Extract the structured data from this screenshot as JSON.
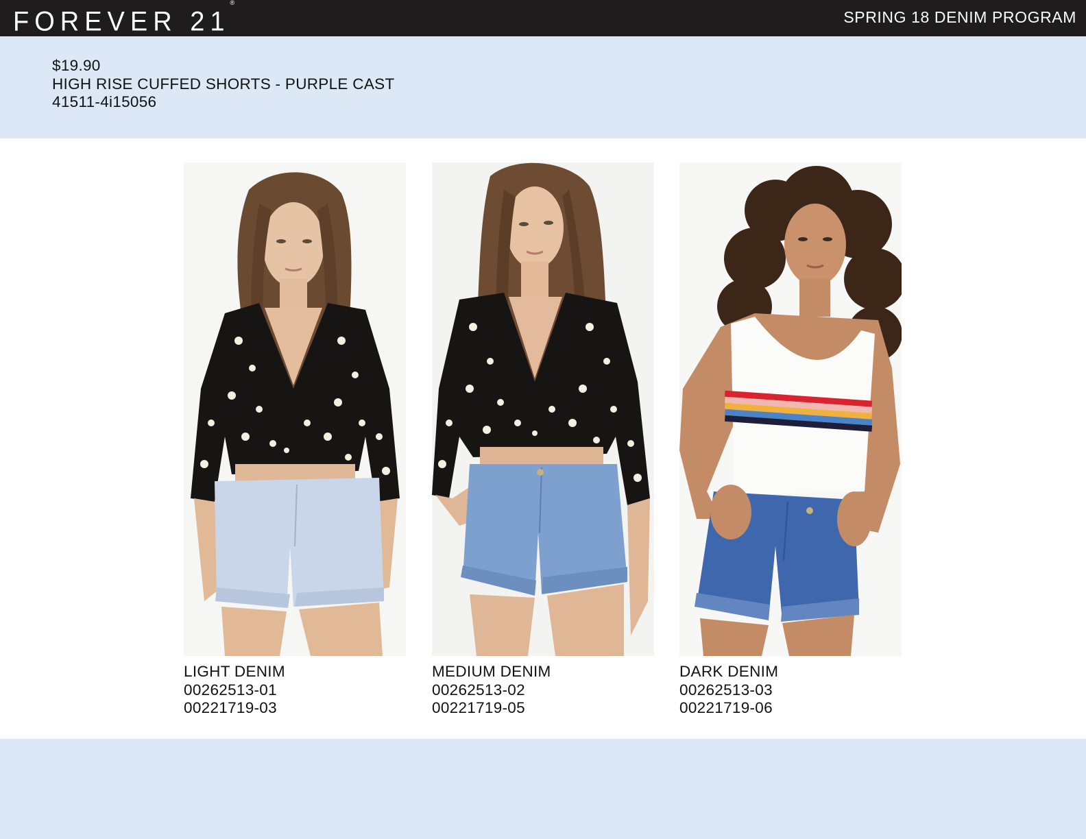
{
  "header": {
    "brand": "FOREVER 21",
    "brand_mark": "®",
    "program": "SPRING 18 DENIM PROGRAM"
  },
  "product": {
    "price": "$19.90",
    "name": "HIGH RISE CUFFED SHORTS - PURPLE CAST",
    "style_number": "41511-4i15056"
  },
  "variants": [
    {
      "label": "LIGHT DENIM",
      "codes": [
        "00262513-01",
        "00221719-03"
      ],
      "image": "model-light-denim-floral-top",
      "denim_color": "#c9d6ea"
    },
    {
      "label": "MEDIUM DENIM",
      "codes": [
        "00262513-02",
        "00221719-05"
      ],
      "image": "model-medium-denim-floral-top",
      "denim_color": "#7ea0cf"
    },
    {
      "label": "DARK DENIM",
      "codes": [
        "00262513-03",
        "00221719-06"
      ],
      "image": "model-dark-denim-striped-tank",
      "denim_color": "#3f67ad"
    }
  ],
  "colors": {
    "topbar": "#1f1c1d",
    "band": "#dce8f6"
  }
}
